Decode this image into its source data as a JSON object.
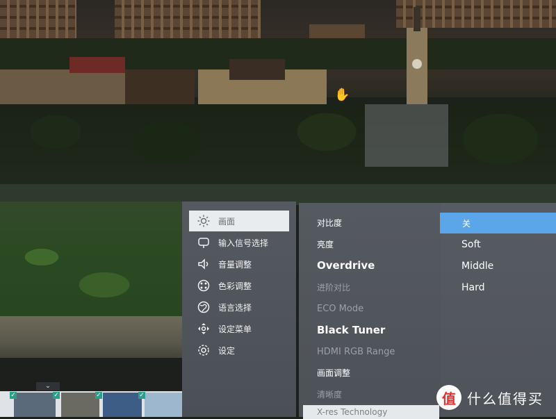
{
  "osd": {
    "left_menu": [
      {
        "label": "画面",
        "icon": "sun-icon",
        "active": true
      },
      {
        "label": "输入信号选择",
        "icon": "input-icon"
      },
      {
        "label": "音量调整",
        "icon": "audio-icon"
      },
      {
        "label": "色彩调整",
        "icon": "color-palette-icon"
      },
      {
        "label": "语言选择",
        "icon": "globe-icon"
      },
      {
        "label": "设定菜单",
        "icon": "menu-settings-icon"
      },
      {
        "label": "设定",
        "icon": "gear-icon"
      }
    ],
    "middle_options": [
      {
        "label": "对比度",
        "style": "normal"
      },
      {
        "label": "亮度",
        "style": "normal"
      },
      {
        "label": "Overdrive",
        "style": "strong"
      },
      {
        "label": "进阶对比",
        "style": "dim"
      },
      {
        "label": "ECO Mode",
        "style": "dim"
      },
      {
        "label": "Black Tuner",
        "style": "strong"
      },
      {
        "label": "HDMI RGB Range",
        "style": "dim"
      },
      {
        "label": "画面调整",
        "style": "normal"
      },
      {
        "label": "清晰度",
        "style": "dim"
      },
      {
        "label": "X-res Technology",
        "style": "highlight"
      }
    ],
    "values": [
      {
        "label": "关",
        "selected": true
      },
      {
        "label": "Soft"
      },
      {
        "label": "Middle"
      },
      {
        "label": "Hard"
      }
    ]
  },
  "watermark": {
    "badge": "值",
    "text": "什么值得买"
  },
  "taskbar": {
    "chevron": "⌄",
    "checks": [
      "✓",
      "✓",
      "✓",
      "✓"
    ]
  }
}
